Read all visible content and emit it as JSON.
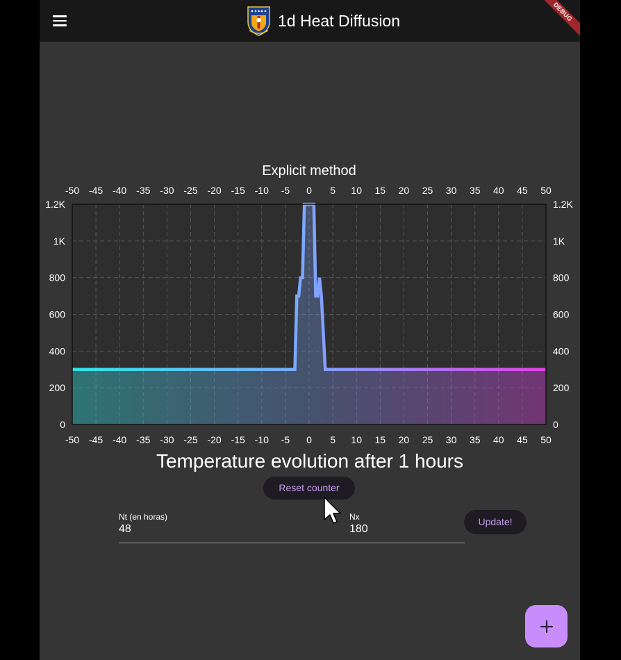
{
  "appbar": {
    "title": "1d Heat Diffusion",
    "debug_label": "DEBUG"
  },
  "chart_data": {
    "type": "area",
    "title": "Explicit method",
    "xlim": [
      -50,
      50
    ],
    "ylim": [
      0,
      1200
    ],
    "x_ticks": [
      "-50",
      "-45",
      "-40",
      "-35",
      "-30",
      "-25",
      "-20",
      "-15",
      "-10",
      "-5",
      "0",
      "5",
      "10",
      "15",
      "20",
      "25",
      "30",
      "35",
      "40",
      "45",
      "50"
    ],
    "y_ticks": [
      "0",
      "200",
      "400",
      "600",
      "800",
      "1K",
      "1.2K"
    ],
    "x_tick_values": [
      -50,
      -45,
      -40,
      -35,
      -30,
      -25,
      -20,
      -15,
      -10,
      -5,
      0,
      5,
      10,
      15,
      20,
      25,
      30,
      35,
      40,
      45,
      50
    ],
    "y_tick_values": [
      0,
      200,
      400,
      600,
      800,
      1000,
      1200
    ],
    "grid": true,
    "series": [
      {
        "x": [
          -50,
          -3,
          -2.6,
          -2.2,
          -1.8,
          -1.4,
          -1.0,
          0.5,
          1.0,
          1.4,
          1.8,
          2.2,
          2.6,
          3.4,
          50
        ],
        "y": [
          300,
          300,
          700,
          700,
          800,
          800,
          1200,
          1200,
          1200,
          700,
          700,
          800,
          700,
          300,
          300
        ]
      }
    ],
    "colors": {
      "start": "#2ee6e6",
      "mid": "#7ea6ff",
      "end": "#e040e6"
    }
  },
  "main": {
    "temperature_title": "Temperature evolution after 1 hours",
    "reset_label": "Reset counter",
    "update_label": "Update!",
    "nt_label": "Nt (en horas)",
    "nt_value": "48",
    "nx_label": "Nx",
    "nx_value": "180",
    "fab_icon": "plus-icon"
  }
}
